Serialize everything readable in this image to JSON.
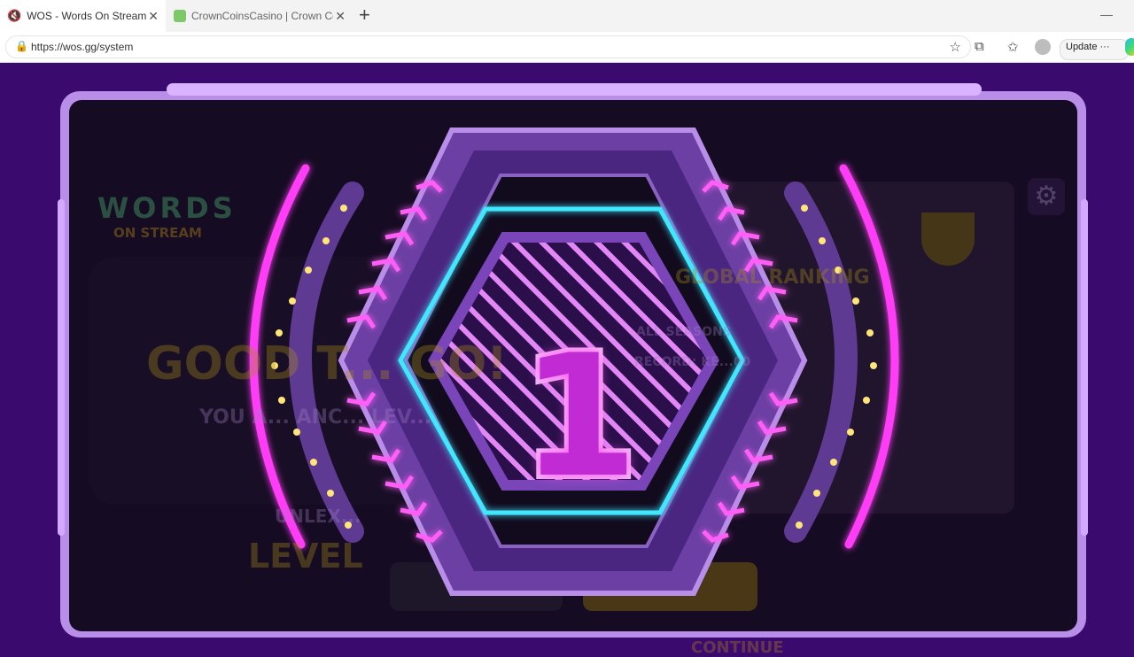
{
  "browser": {
    "tabs": [
      {
        "title": "WOS - Words On Stream",
        "active": true
      },
      {
        "title": "CrownCoinsCasino | Crown Coins",
        "active": false
      }
    ],
    "url": "https://wos.gg/system",
    "update_label": "Update",
    "more_label": "···"
  },
  "game": {
    "logo_top": "WORDS",
    "logo_bottom": "ON STREAM",
    "background_heading": "GOOD T... GO!",
    "background_sub": "YOU A... ANC... LEV...",
    "unlock_text": "UNLEX...",
    "level_text": "LEVEL",
    "ranking_title": "GLOBAL RANKING",
    "all_seasons": "ALL SEASONS",
    "record": "RECORD: KE...00",
    "continue_label": "CONTINUE",
    "countdown": "1",
    "colors": {
      "neon_pink": "#ff3df6",
      "neon_cyan": "#3fe7ff",
      "bg_purple": "#3b0a6e",
      "frame_lilac": "#c79bf2"
    }
  }
}
